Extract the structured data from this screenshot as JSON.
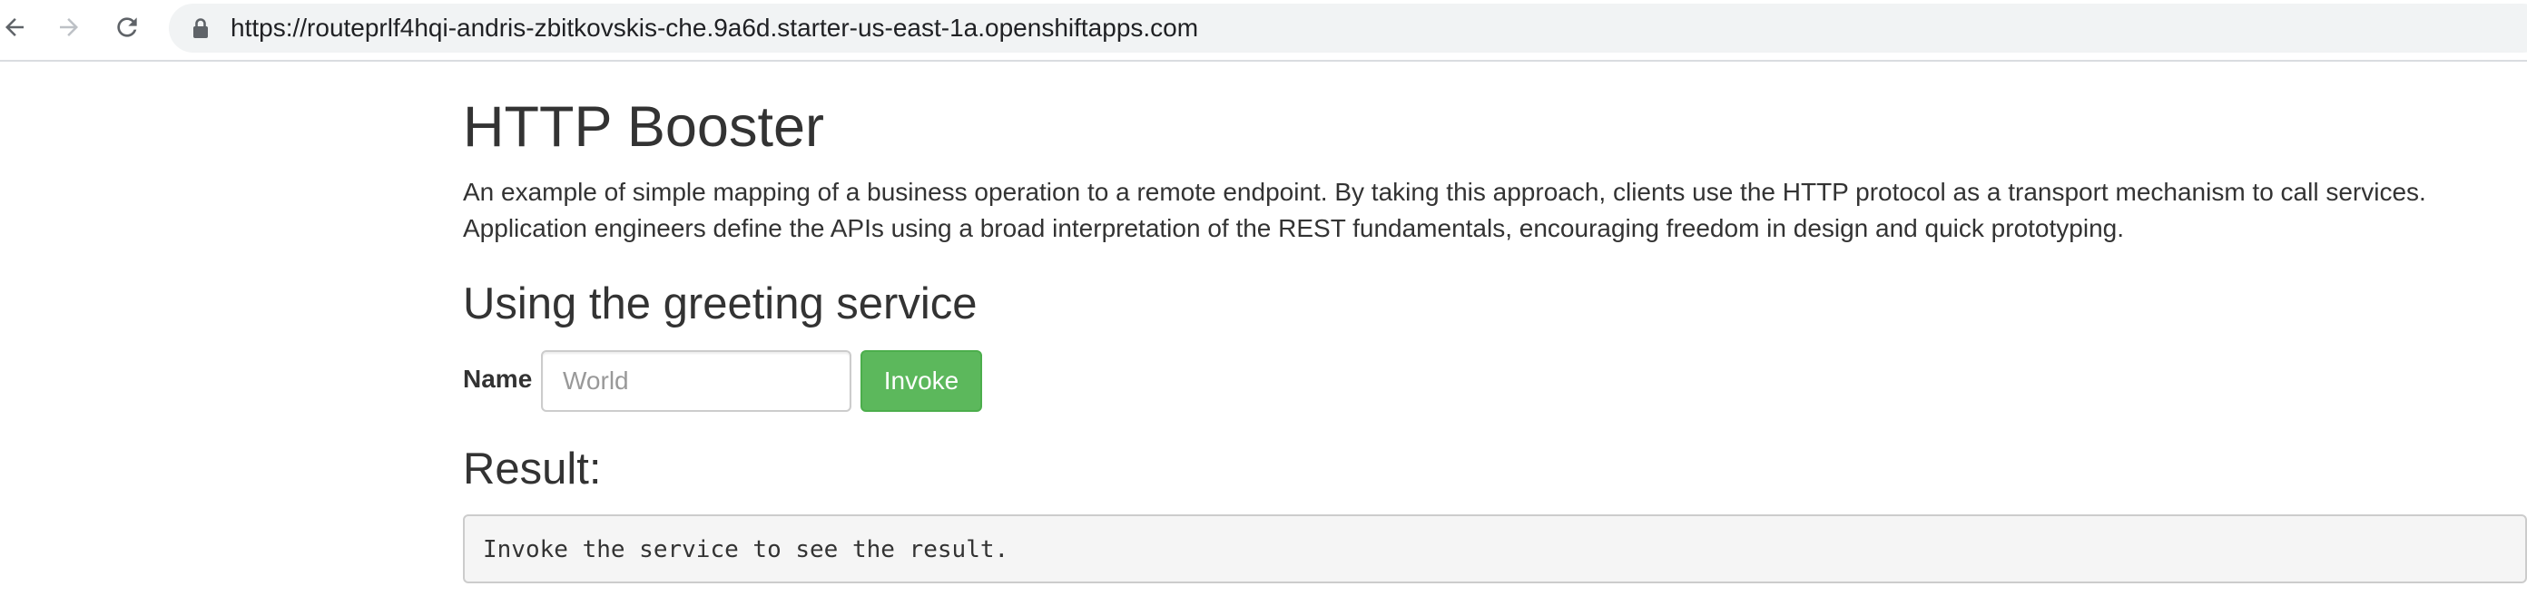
{
  "browser": {
    "url": "https://routeprlf4hqi-andris-zbitkovskis-che.9a6d.starter-us-east-1a.openshiftapps.com",
    "icons": {
      "back": "back-arrow-icon",
      "forward": "forward-arrow-icon",
      "reload": "reload-icon",
      "lock": "lock-icon"
    }
  },
  "page": {
    "title": "HTTP Booster",
    "description": "An example of simple mapping of a business operation to a remote endpoint. By taking this approach, clients use the HTTP protocol as a transport mechanism to call services. Application engineers define the APIs using a broad interpretation of the REST fundamentals, encouraging freedom in design and quick prototyping.",
    "section_title": "Using the greeting service",
    "form": {
      "name_label": "Name",
      "name_placeholder": "World",
      "name_value": "",
      "invoke_label": "Invoke"
    },
    "result_title": "Result:",
    "result_text": "Invoke the service to see the result."
  },
  "colors": {
    "button_green": "#5cb85c",
    "text": "#333333",
    "result_background": "#f5f5f5"
  }
}
